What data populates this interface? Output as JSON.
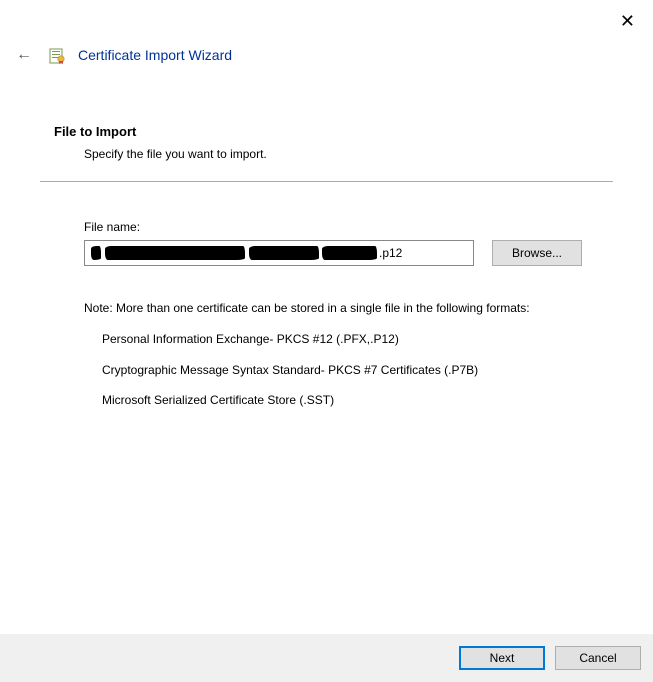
{
  "window": {
    "title": "Certificate Import Wizard"
  },
  "section": {
    "heading": "File to Import",
    "subheading": "Specify the file you want to import."
  },
  "file": {
    "label": "File name:",
    "value_suffix": ".p12",
    "browse_label": "Browse..."
  },
  "note": {
    "lead": "Note:  More than one certificate can be stored in a single file in the following formats:",
    "items": [
      "Personal Information Exchange- PKCS #12 (.PFX,.P12)",
      "Cryptographic Message Syntax Standard- PKCS #7 Certificates (.P7B)",
      "Microsoft Serialized Certificate Store (.SST)"
    ]
  },
  "footer": {
    "next": "Next",
    "cancel": "Cancel"
  }
}
